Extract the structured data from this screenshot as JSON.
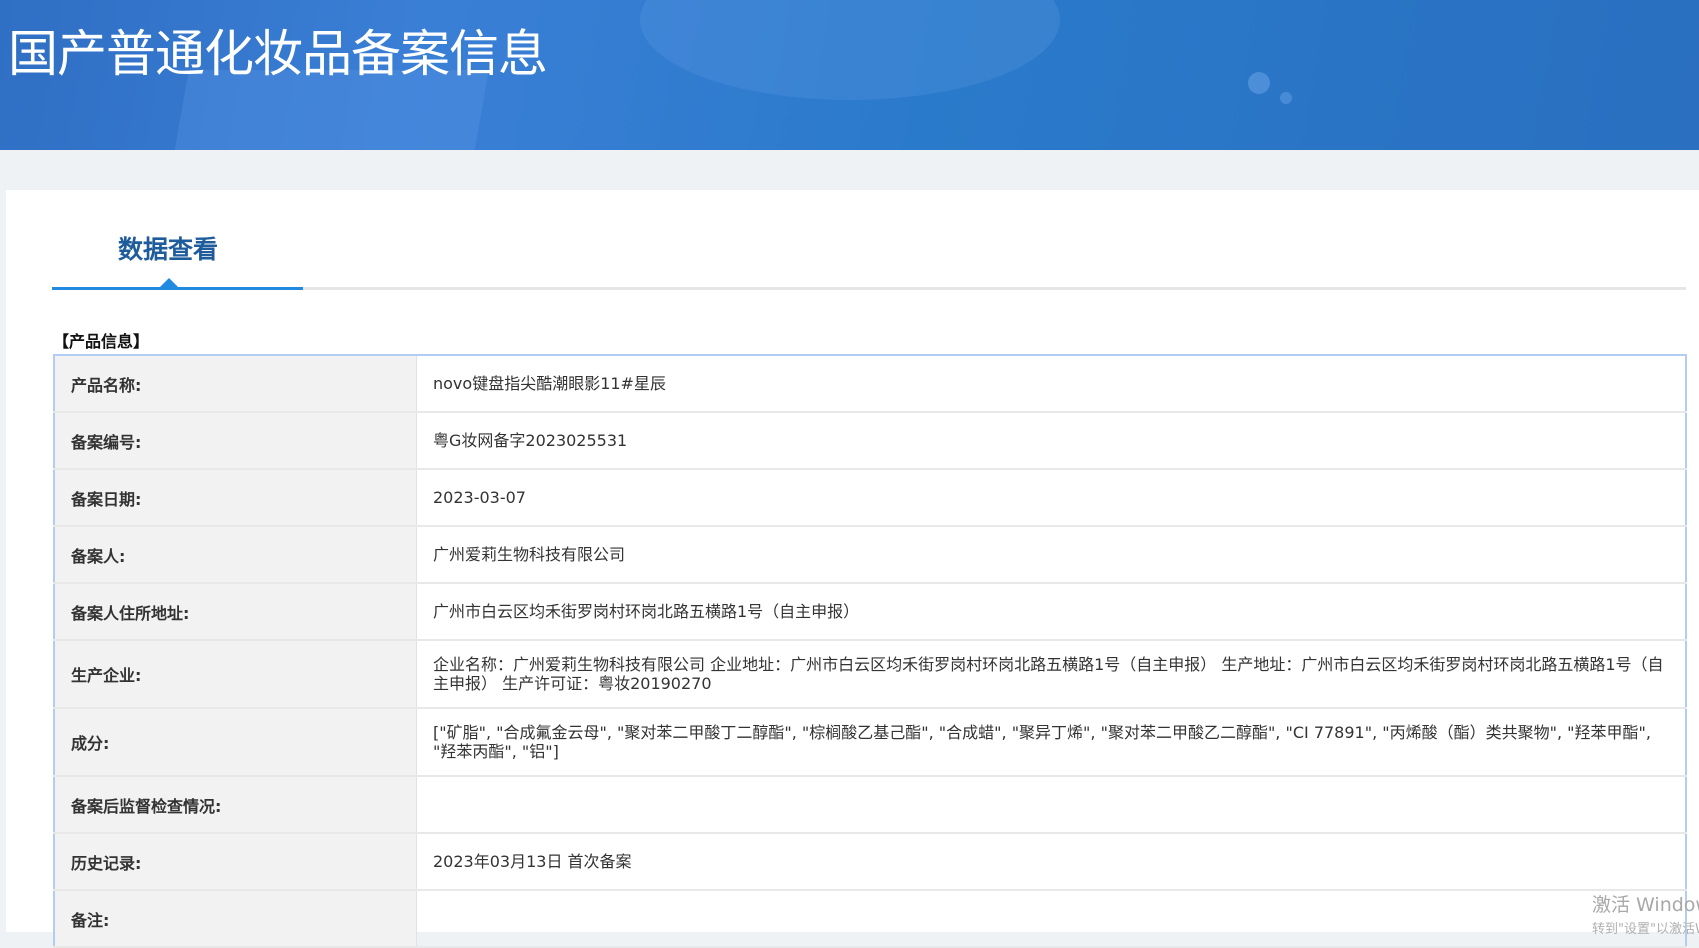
{
  "header": {
    "title": "国产普通化妆品备案信息"
  },
  "tabs": [
    {
      "label": "数据查看",
      "active": true
    }
  ],
  "section_title": "【产品信息】",
  "rows": [
    {
      "label": "产品名称:",
      "value": "novo键盘指尖酷潮眼影11#星辰"
    },
    {
      "label": "备案编号:",
      "value": "粤G妆网备字2023025531"
    },
    {
      "label": "备案日期:",
      "value": "2023-03-07"
    },
    {
      "label": "备案人:",
      "value": "广州爱莉生物科技有限公司"
    },
    {
      "label": "备案人住所地址:",
      "value": "广州市白云区均禾街罗岗村环岗北路五横路1号（自主申报）"
    },
    {
      "label": "生产企业:",
      "value": "企业名称：广州爱莉生物科技有限公司 企业地址：广州市白云区均禾街罗岗村环岗北路五横路1号（自主申报） 生产地址：广州市白云区均禾街罗岗村环岗北路五横路1号（自主申报） 生产许可证：粤妆20190270"
    },
    {
      "label": "成分:",
      "value": "[\"矿脂\", \"合成氟金云母\", \"聚对苯二甲酸丁二醇酯\", \"棕榈酸乙基己酯\", \"合成蜡\", \"聚异丁烯\", \"聚对苯二甲酸乙二醇酯\", \"CI 77891\", \"丙烯酸（酯）类共聚物\", \"羟苯甲酯\", \"羟苯丙酯\", \"铝\"]"
    },
    {
      "label": "备案后监督检查情况:",
      "value": ""
    },
    {
      "label": "历史记录:",
      "value": "2023年03月13日 首次备案"
    },
    {
      "label": "备注:",
      "value": ""
    }
  ],
  "watermark": {
    "line1": "激活 Windows",
    "line2": "转到\"设置\"以激活Windows。"
  },
  "colors": {
    "accent": "#1f8ae0",
    "tab_text": "#1e5c9b",
    "header": "#2f6fc4"
  }
}
